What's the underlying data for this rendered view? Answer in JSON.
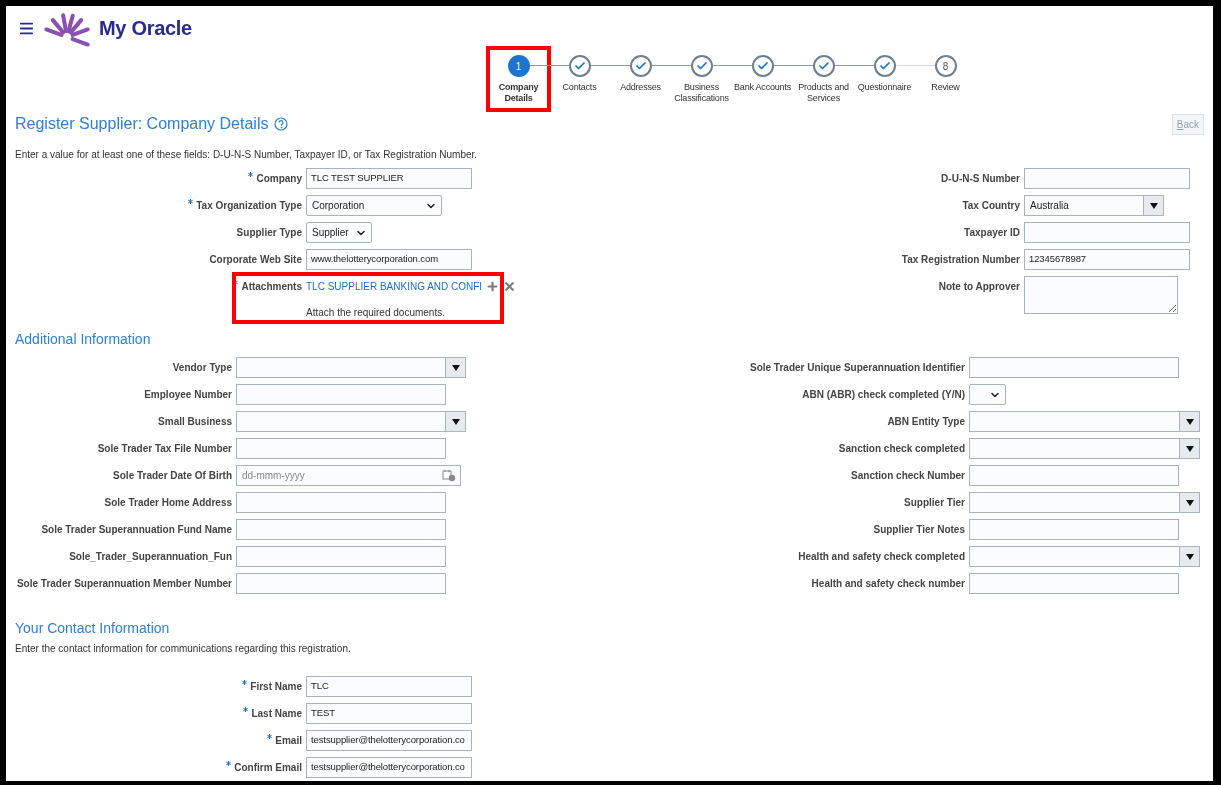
{
  "header": {
    "logo_text": "My Oracle"
  },
  "steps": [
    {
      "number": "1",
      "label": "Company Details",
      "kind": "current",
      "highlighted": true
    },
    {
      "label": "Contacts",
      "kind": "done",
      "highlighted": false
    },
    {
      "label": "Addresses",
      "kind": "done",
      "highlighted": false
    },
    {
      "label": "Business Classifications",
      "kind": "done",
      "highlighted": false
    },
    {
      "label": "Bank Accounts",
      "kind": "done",
      "highlighted": false
    },
    {
      "label": "Products and Services",
      "kind": "done",
      "highlighted": false
    },
    {
      "label": "Questionnaire",
      "kind": "done",
      "highlighted": false
    },
    {
      "number": "8",
      "label": "Review",
      "kind": "pending",
      "highlighted": false
    }
  ],
  "company_section": {
    "title": "Register Supplier: Company Details",
    "back_button": {
      "label": "Back",
      "disabled": true
    },
    "instruction": "Enter a value for at least one of these fields: D-U-N-S Number, Taxpayer ID, or Tax Registration Number.",
    "left": [
      {
        "label": "Company",
        "required": true,
        "kind": "text",
        "value": "TLC TEST SUPPLIER"
      },
      {
        "label": "Tax Organization Type",
        "required": true,
        "kind": "select",
        "value": "Corporation"
      },
      {
        "label": "Supplier Type",
        "required": false,
        "kind": "compact",
        "value": "Supplier"
      },
      {
        "label": "Corporate Web Site",
        "required": false,
        "kind": "text",
        "value": "www.thelotterycorporation.com"
      },
      {
        "label": "Attachments",
        "required": true,
        "kind": "attachment",
        "value": "TLC SUPPLIER BANKING AND CONFI",
        "note": "Attach the required documents.",
        "highlighted": true
      }
    ],
    "right": [
      {
        "label": "D-U-N-S Number",
        "required": false,
        "kind": "text"
      },
      {
        "label": "Tax Country",
        "required": false,
        "kind": "combo",
        "value": "Australia"
      },
      {
        "label": "Taxpayer ID",
        "required": false,
        "kind": "text"
      },
      {
        "label": "Tax Registration Number",
        "required": false,
        "kind": "text",
        "value": "12345678987"
      },
      {
        "label": "Note to Approver",
        "required": false,
        "kind": "textarea"
      }
    ]
  },
  "additional_section": {
    "title": "Additional Information",
    "left": [
      {
        "label": "Vendor Type",
        "required": false,
        "kind": "combo"
      },
      {
        "label": "Employee Number",
        "required": false,
        "kind": "text"
      },
      {
        "label": "Small Business",
        "required": false,
        "kind": "combo"
      },
      {
        "label": "Sole Trader Tax File Number",
        "required": false,
        "kind": "text"
      },
      {
        "label": "Sole Trader Date Of Birth",
        "required": false,
        "kind": "date",
        "placeholder": "dd-mmm-yyyy"
      },
      {
        "label": "Sole Trader Home Address",
        "required": false,
        "kind": "text"
      },
      {
        "label": "Sole Trader Superannuation Fund Name",
        "required": false,
        "kind": "text"
      },
      {
        "label": "Sole_Trader_Superannuation_Fun",
        "required": false,
        "kind": "text"
      },
      {
        "label": "Sole Trader Superannuation Member Number",
        "required": false,
        "kind": "text"
      }
    ],
    "right": [
      {
        "label": "Sole Trader Unique Superannuation Identifier",
        "required": false,
        "kind": "text"
      },
      {
        "label": "ABN (ABR) check completed (Y/N)",
        "required": false,
        "kind": "compact"
      },
      {
        "label": "ABN Entity Type",
        "required": false,
        "kind": "combo"
      },
      {
        "label": "Sanction check completed",
        "required": false,
        "kind": "combo"
      },
      {
        "label": "Sanction check Number",
        "required": false,
        "kind": "text"
      },
      {
        "label": "Supplier Tier",
        "required": false,
        "kind": "combo"
      },
      {
        "label": "Supplier Tier Notes",
        "required": false,
        "kind": "text"
      },
      {
        "label": "Health and safety check completed",
        "required": false,
        "kind": "combo"
      },
      {
        "label": "Health and safety check number",
        "required": false,
        "kind": "text"
      }
    ]
  },
  "contact_section": {
    "title": "Your Contact Information",
    "instruction": "Enter the contact information for communications regarding this registration.",
    "left": [
      {
        "label": "First Name",
        "required": true,
        "kind": "text",
        "value": "TLC"
      },
      {
        "label": "Last Name",
        "required": true,
        "kind": "text",
        "value": "TEST"
      },
      {
        "label": "Email",
        "required": true,
        "kind": "text",
        "value": "testsupplier@thelotterycorporation.co"
      },
      {
        "label": "Confirm Email",
        "required": true,
        "kind": "text",
        "value": "testsupplier@thelotterycorporation.co"
      }
    ]
  }
}
